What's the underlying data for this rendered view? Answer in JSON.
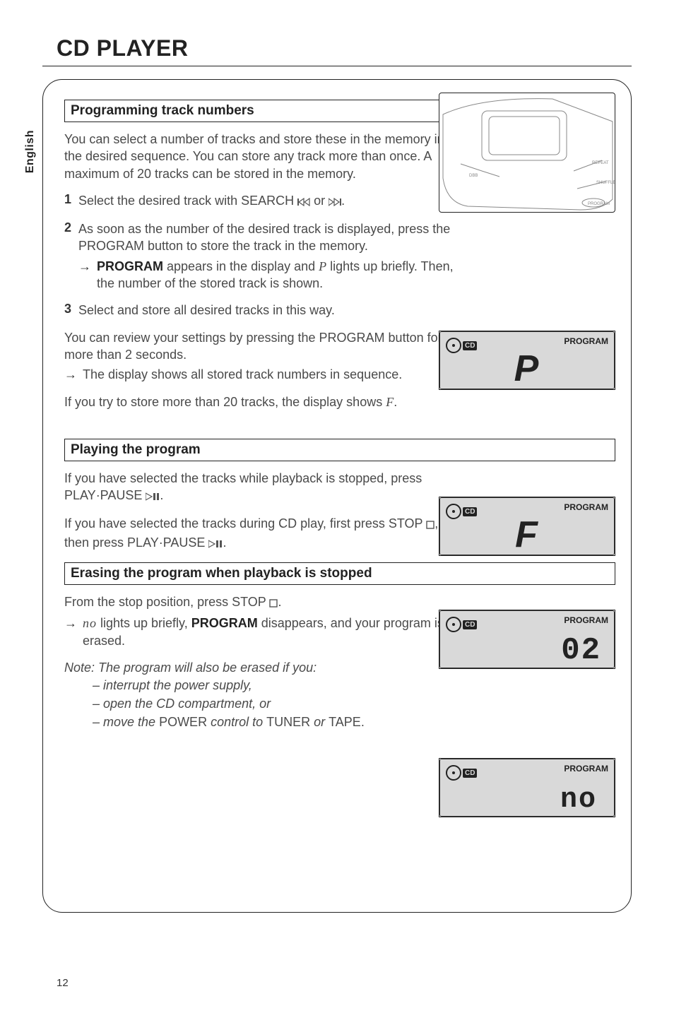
{
  "lang_tab": "English",
  "title": "CD PLAYER",
  "section_prog_title": "Programming track numbers",
  "prog_intro": "You can select a number of tracks and store these in the memory in the desired sequence. You can store any track more than once. A maximum of 20 tracks can be stored in the memory.",
  "step1_num": "1",
  "step1_pre": "Select the desired track with SEARCH ",
  "step1_mid": " or ",
  "step1_post": ".",
  "step2_num": "2",
  "step2_text": "As soon as the number of the desired track is displayed, press the PROGRAM button to store the track in the memory.",
  "step2_sub_a": "PROGRAM",
  "step2_sub_a_pre": " appears in the display and ",
  "step2_sub_a_mid": " lights up briefly. Then, the number of the stored track is shown.",
  "step3_num": "3",
  "step3_text": "Select and store all desired tracks in this way.",
  "review_text": "You can review your settings by pressing the PROGRAM button for more than 2 seconds.",
  "review_sub": "The display shows all stored track numbers in sequence.",
  "overflow_pre": "If you try to store more than 20 tracks, the display shows ",
  "overflow_post": ".",
  "section_play_title": "Playing the program",
  "play_p1_pre": "If you have selected the tracks while playback is stopped, press PLAY·PAUSE ",
  "play_p1_post": ".",
  "play_p2_pre": "If you have selected the tracks during CD play, first press STOP ",
  "play_p2_mid": ", then press PLAY·PAUSE ",
  "play_p2_post": ".",
  "section_erase_title": "Erasing the program when playback is stopped",
  "erase_p1_pre": "From the stop position, press STOP ",
  "erase_p1_post": ".",
  "erase_sub_pre": " lights up briefly, ",
  "erase_sub_bold": "PROGRAM",
  "erase_sub_post": " disappears, and your program is erased.",
  "note_title": "Note: The program will also be erased if you:",
  "note_items": [
    "interrupt the power supply,",
    "open the CD compartment, or"
  ],
  "note_last_pre": "move the ",
  "note_last_b1": "POWER",
  "note_last_mid": " control to ",
  "note_last_b2": "TUNER",
  "note_last_or": " or ",
  "note_last_b3": "TAPE.",
  "page_number": "12",
  "lcd": {
    "cd_label": "CD",
    "program": "PROGRAM",
    "disp_p": "P",
    "disp_f": "F",
    "disp_02": "02",
    "disp_no_segment": "no",
    "disp_no_ital": "no"
  }
}
